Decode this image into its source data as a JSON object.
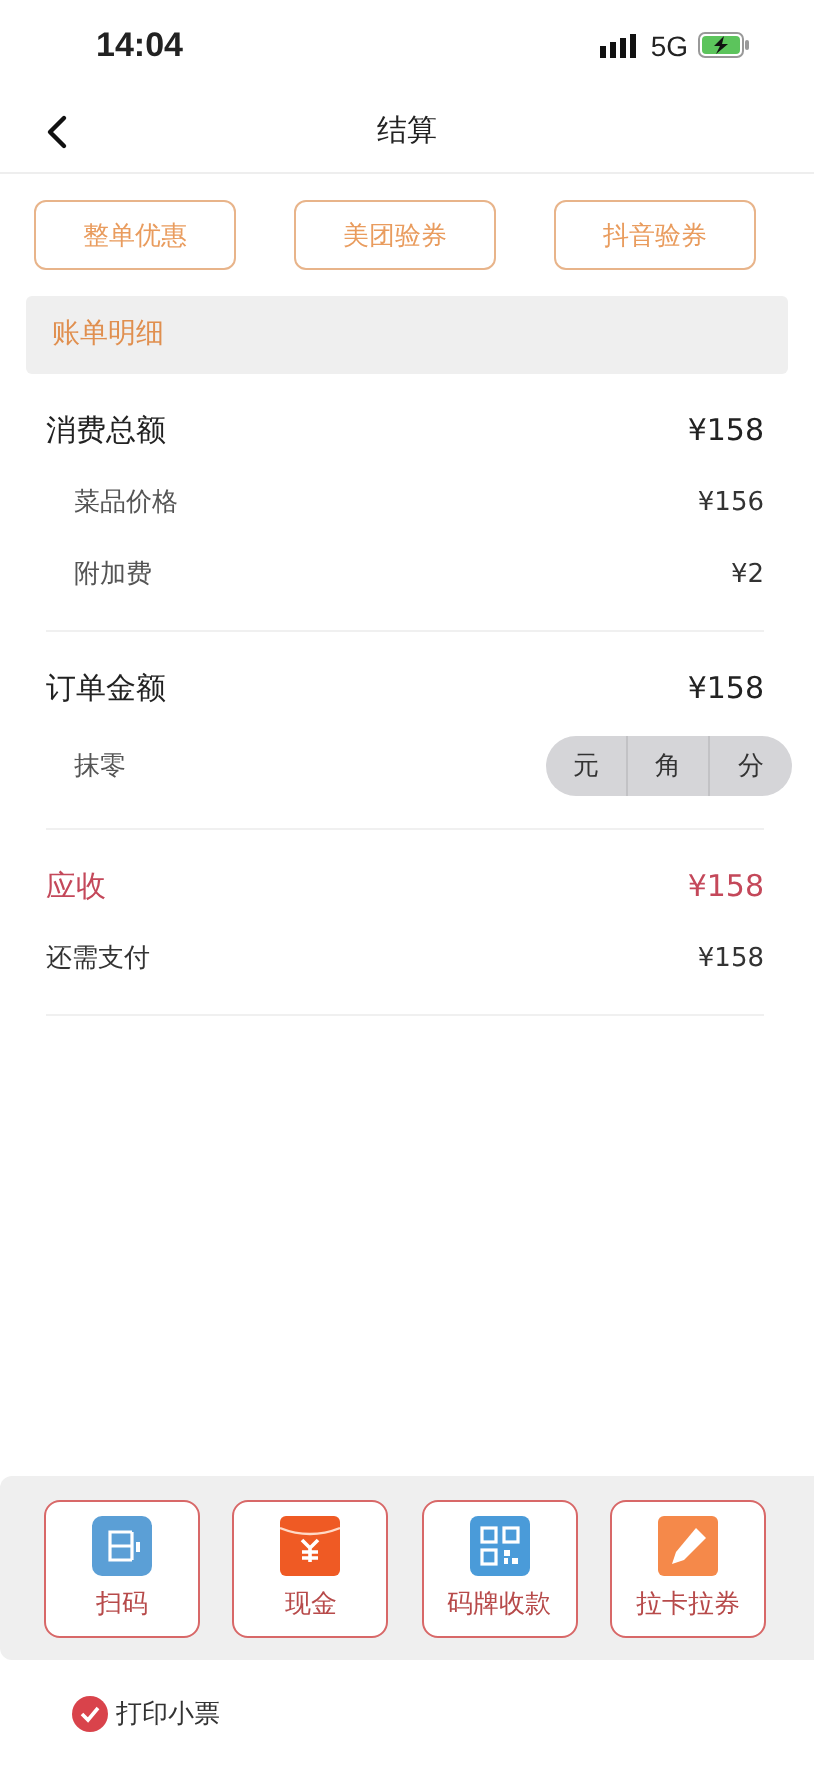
{
  "status_bar": {
    "time": "14:04",
    "network": "5G"
  },
  "nav": {
    "title": "结算"
  },
  "coupons": [
    "整单优惠",
    "美团验券",
    "抖音验券"
  ],
  "bill": {
    "title": "账单明细",
    "sections": [
      [
        {
          "kind": "main",
          "label": "消费总额",
          "value": "¥158"
        },
        {
          "kind": "sub",
          "label": "菜品价格",
          "value": "¥156"
        },
        {
          "kind": "sub",
          "label": "附加费",
          "value": "¥2"
        }
      ],
      [
        {
          "kind": "main",
          "label": "订单金额",
          "value": "¥158"
        },
        {
          "kind": "rounding",
          "label": "抹零",
          "options": [
            {
              "label": "元",
              "selected": false
            },
            {
              "label": "角",
              "selected": false
            },
            {
              "label": "分",
              "selected": false
            }
          ]
        }
      ],
      [
        {
          "kind": "due",
          "label": "应收",
          "value": "¥158"
        },
        {
          "kind": "plain",
          "label": "还需支付",
          "value": "¥158"
        }
      ]
    ]
  },
  "payment_methods": [
    {
      "kind": "scan",
      "label": "扫码"
    },
    {
      "kind": "cash",
      "label": "现金"
    },
    {
      "kind": "qr",
      "label": "码牌收款"
    },
    {
      "kind": "card",
      "label": "拉卡拉券"
    }
  ],
  "print_receipt": {
    "label": "打印小票",
    "checked": true
  }
}
